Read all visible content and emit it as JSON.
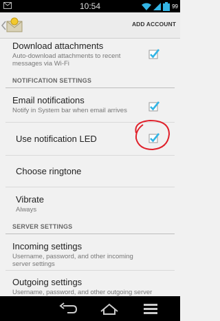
{
  "status_bar": {
    "time": "10:54",
    "battery": "99"
  },
  "action_bar": {
    "add_account_label": "ADD ACCOUNT"
  },
  "settings": {
    "download_attachments": {
      "title": "Download attachments",
      "summary_line1": "Auto-download attachments to recent",
      "summary_line2": "messages via Wi-Fi",
      "checked": true
    },
    "notification_header": "NOTIFICATION SETTINGS",
    "email_notifications": {
      "title": "Email notifications",
      "summary": "Notify in System bar when email arrives",
      "checked": true
    },
    "use_notification_led": {
      "title": "Use notification LED",
      "checked": true
    },
    "choose_ringtone": {
      "title": "Choose ringtone"
    },
    "vibrate": {
      "title": "Vibrate",
      "summary": "Always"
    },
    "server_header": "SERVER SETTINGS",
    "incoming_settings": {
      "title": "Incoming settings",
      "summary_line1": "Username, password, and other incoming",
      "summary_line2": "server settings"
    },
    "outgoing_settings": {
      "title": "Outgoing settings",
      "summary_line1": "Username, password, and other outgoing server"
    }
  },
  "colors": {
    "checkbox_blue": "#33b5e5",
    "annotation_red": "#e0202a"
  },
  "icons": {
    "nav_back": "back-icon",
    "nav_home": "home-icon",
    "nav_recents": "recents-icon",
    "overflow": "menu-icon"
  }
}
